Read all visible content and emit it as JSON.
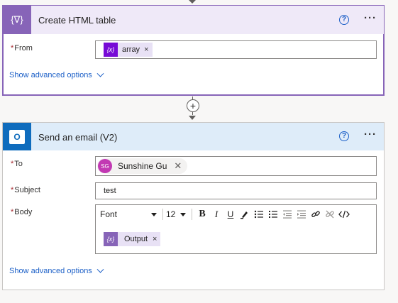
{
  "card1": {
    "title": "Create HTML table",
    "icon": "curly-variable-icon",
    "icon_glyph": "{∇}",
    "help_glyph": "?",
    "more_glyph": "···",
    "from_label": "From",
    "from_token": {
      "label": "array",
      "icon_glyph": "{x}",
      "remove": "×"
    },
    "advanced_label": "Show advanced options",
    "accent": "#8764b8"
  },
  "add_step_glyph": "+",
  "card2": {
    "title": "Send an email (V2)",
    "icon": "outlook-icon",
    "icon_glyph": "O",
    "help_glyph": "?",
    "more_glyph": "···",
    "to_label": "To",
    "to_person": {
      "initials": "SG",
      "name": "Sunshine Gu",
      "remove": "✕"
    },
    "subject_label": "Subject",
    "subject_value": "test",
    "body_label": "Body",
    "toolbar": {
      "font": "Font",
      "size": "12",
      "bold": "B",
      "italic": "I",
      "underline": "U"
    },
    "body_token": {
      "label": "Output",
      "icon_glyph": "{x}",
      "remove": "×"
    },
    "advanced_label": "Show advanced options",
    "accent": "#0f6cbd",
    "header_bg": "#deecf9"
  },
  "required_marker": "*"
}
